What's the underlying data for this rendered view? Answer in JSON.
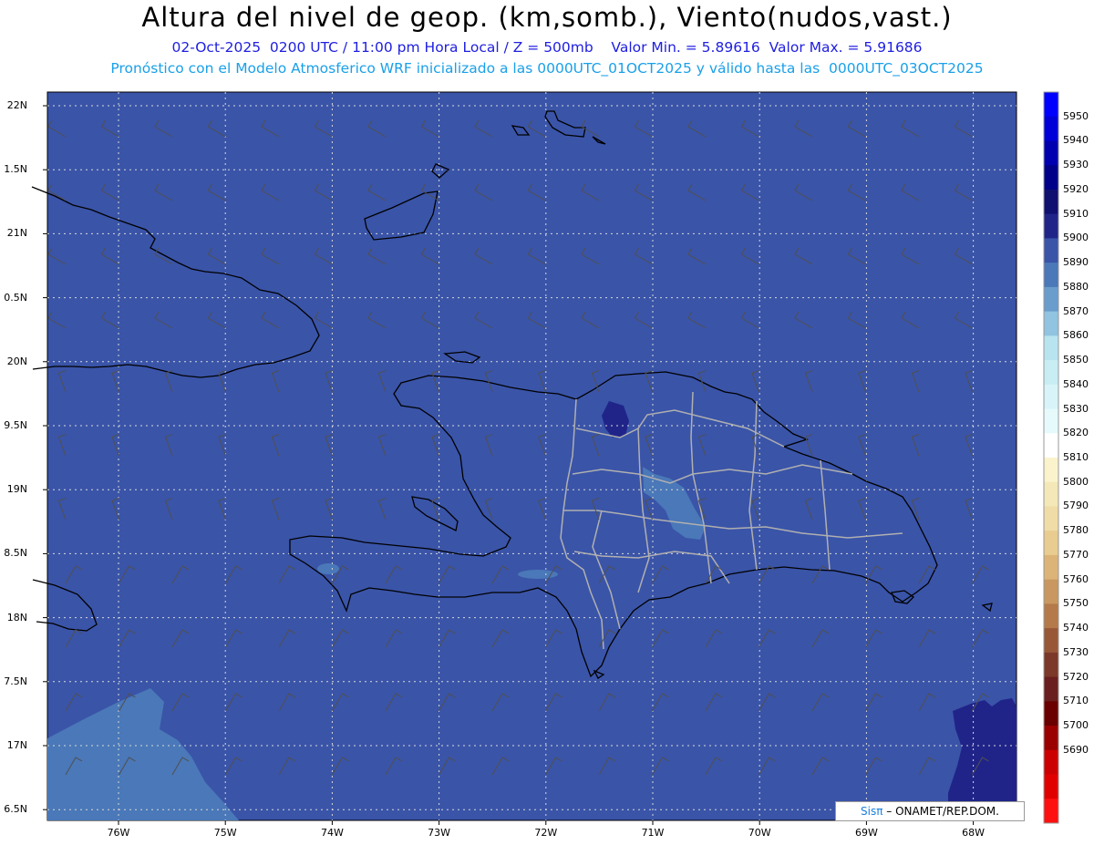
{
  "title": "Altura del nivel de geop. (km,somb.), Viento(nudos,vast.)",
  "subtitle_line1": "02-Oct-2025  0200 UTC / 11:00 pm Hora Local / Z = 500mb    Valor Min. = 5.89616  Valor Max. = 5.91686",
  "subtitle_line2": "Pronóstico con el Modelo Atmosferico WRF inicializado a las 0000UTC_01OCT2025 y válido hasta las  0000UTC_03OCT2025",
  "credit": {
    "sis": "Sisπ",
    "rest": " – ONAMET/REP.DOM."
  },
  "axes": {
    "lat_labels": [
      "22N",
      "1.5N",
      "21N",
      "0.5N",
      "20N",
      "9.5N",
      "19N",
      "8.5N",
      "18N",
      "7.5N",
      "17N",
      "6.5N"
    ],
    "lon_labels": [
      "76W",
      "75W",
      "74W",
      "73W",
      "72W",
      "71W",
      "70W",
      "69W",
      "68W"
    ]
  },
  "colorbar": {
    "levels": [
      "5950",
      "5940",
      "5930",
      "5920",
      "5910",
      "5900",
      "5890",
      "5880",
      "5870",
      "5860",
      "5850",
      "5840",
      "5830",
      "5820",
      "5810",
      "5800",
      "5790",
      "5780",
      "5770",
      "5760",
      "5750",
      "5740",
      "5730",
      "5720",
      "5710",
      "5700",
      "5690"
    ],
    "colors": [
      "#0000ff",
      "#0000d8",
      "#0000b0",
      "#000088",
      "#101070",
      "#202488",
      "#3a54a8",
      "#4a78b8",
      "#6a9ccc",
      "#90c4e0",
      "#b8e4f0",
      "#c8eef4",
      "#d8f4f8",
      "#e6fafc",
      "#ffffff",
      "#faf3cc",
      "#f4e8b8",
      "#f0dca6",
      "#e8cc90",
      "#dcb478",
      "#c89860",
      "#b47a4a",
      "#985838",
      "#7c3828",
      "#6a1e1e",
      "#6a0000",
      "#9a0000",
      "#cc0000",
      "#e00000",
      "#ff1010"
    ]
  },
  "colors": {
    "background_field": "#3a54a8",
    "light_field": "#4a78b8",
    "dark_field": "#202488",
    "coast": "#000000",
    "borders": "#b0b0b0"
  }
}
